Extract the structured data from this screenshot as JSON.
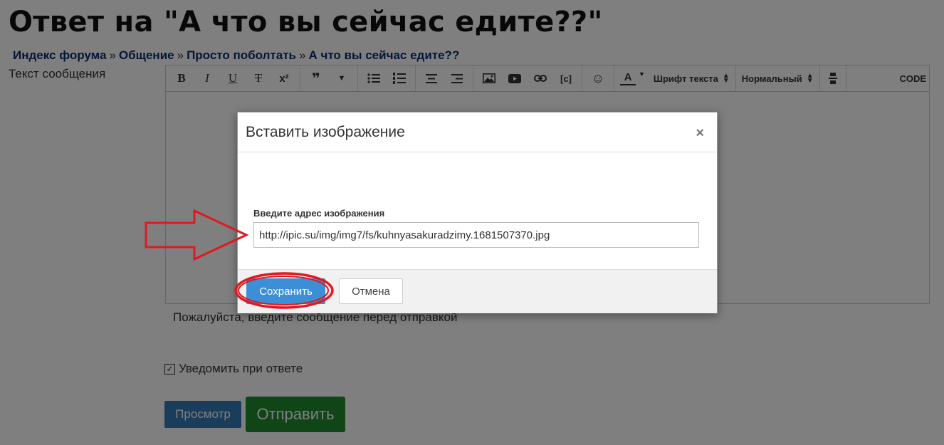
{
  "page": {
    "title": "Ответ на \"А что вы сейчас едите??\"",
    "breadcrumb": [
      {
        "label": "Индекс форума"
      },
      {
        "label": "Общение"
      },
      {
        "label": "Просто поболтать"
      },
      {
        "label": "А что вы сейчас едите??"
      }
    ],
    "breadcrumb_separator": "»",
    "message_label": "Текст сообщения",
    "empty_message_hint": "Пожалуйста, введите сообщение перед отправкой",
    "notify_label": "Уведомить при ответе",
    "notify_checked": true,
    "preview_button": "Просмотр",
    "send_button": "Отправить"
  },
  "editor": {
    "toolbar": {
      "bold": "B",
      "italic": "I",
      "underline": "U",
      "strike": "T",
      "superscript": "x²",
      "quote": "❞",
      "font_color": "A",
      "font_family": "Шрифт текста",
      "font_size": "Нормальный",
      "code": "CODE"
    }
  },
  "modal": {
    "title": "Вставить изображение",
    "close": "×",
    "input_label": "Введите адрес изображения",
    "input_value": "http://ipic.su/img/img7/fs/kuhnyasakuradzimy.1681507370.jpg",
    "save_button": "Сохранить",
    "cancel_button": "Отмена"
  },
  "colors": {
    "breadcrumb": "#0b2d6e",
    "preview_button": "#337ab7",
    "send_button": "#1e8a2e",
    "save_button": "#3c8fd6",
    "annotation": "#e0191f"
  }
}
